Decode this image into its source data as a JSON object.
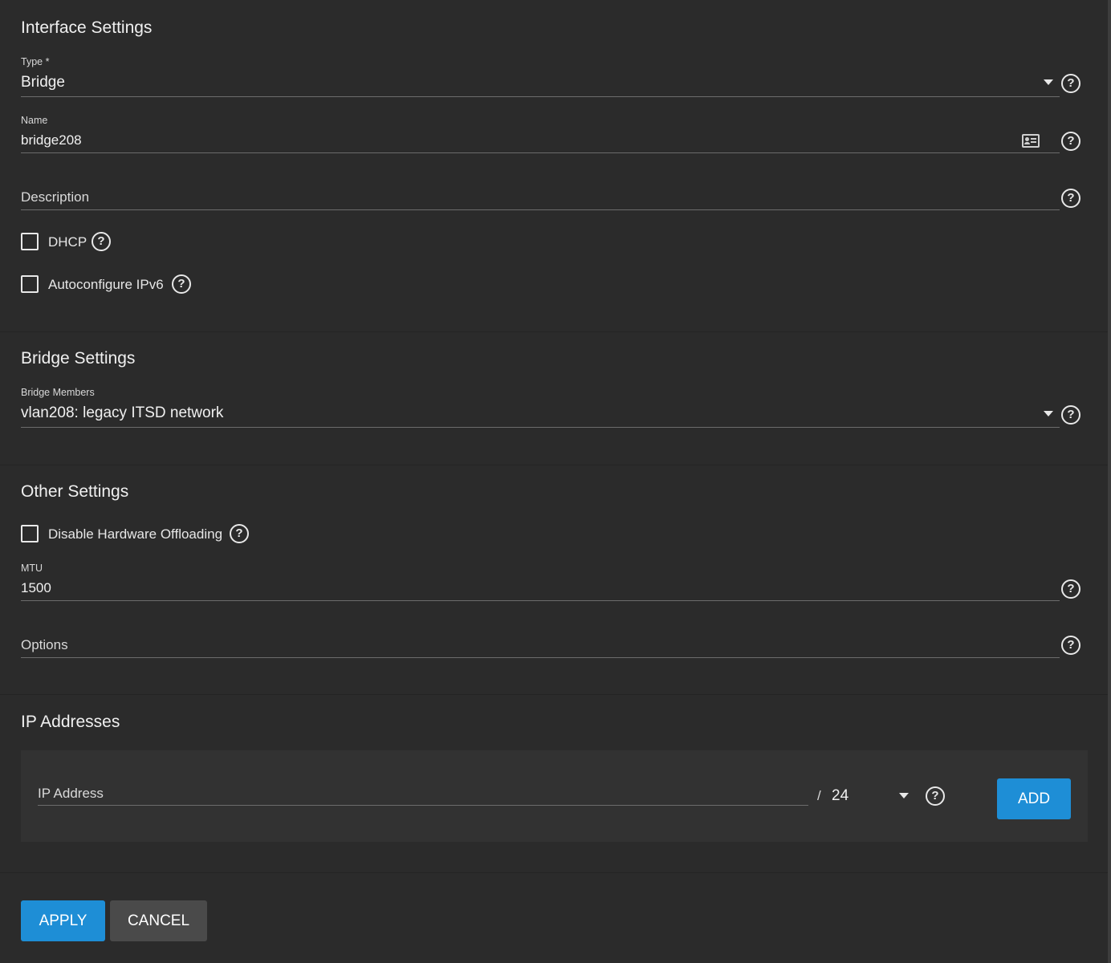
{
  "interface": {
    "heading": "Interface Settings",
    "type_label": "Type *",
    "type_value": "Bridge",
    "name_label": "Name",
    "name_value": "bridge208",
    "description_placeholder": "Description",
    "dhcp_label": "DHCP",
    "ipv6_label": "Autoconfigure IPv6"
  },
  "bridge": {
    "heading": "Bridge Settings",
    "members_label": "Bridge Members",
    "members_value": "vlan208: legacy ITSD network"
  },
  "other": {
    "heading": "Other Settings",
    "offload_label": "Disable Hardware Offloading",
    "mtu_label": "MTU",
    "mtu_value": "1500",
    "options_placeholder": "Options"
  },
  "ip": {
    "heading": "IP Addresses",
    "address_placeholder": "IP Address",
    "slash": "/",
    "netmask_value": "24",
    "add_label": "ADD"
  },
  "actions": {
    "apply_label": "APPLY",
    "cancel_label": "CANCEL"
  },
  "icons": {
    "help": "?",
    "dropdown": "caret-down-icon",
    "card": "id-card-icon",
    "checkbox": "checkbox-unchecked"
  },
  "colors": {
    "background": "#2b2b2b",
    "primary_button": "#1e8ed6",
    "secondary_button": "#4a4a4a",
    "ip_panel": "#323232"
  }
}
